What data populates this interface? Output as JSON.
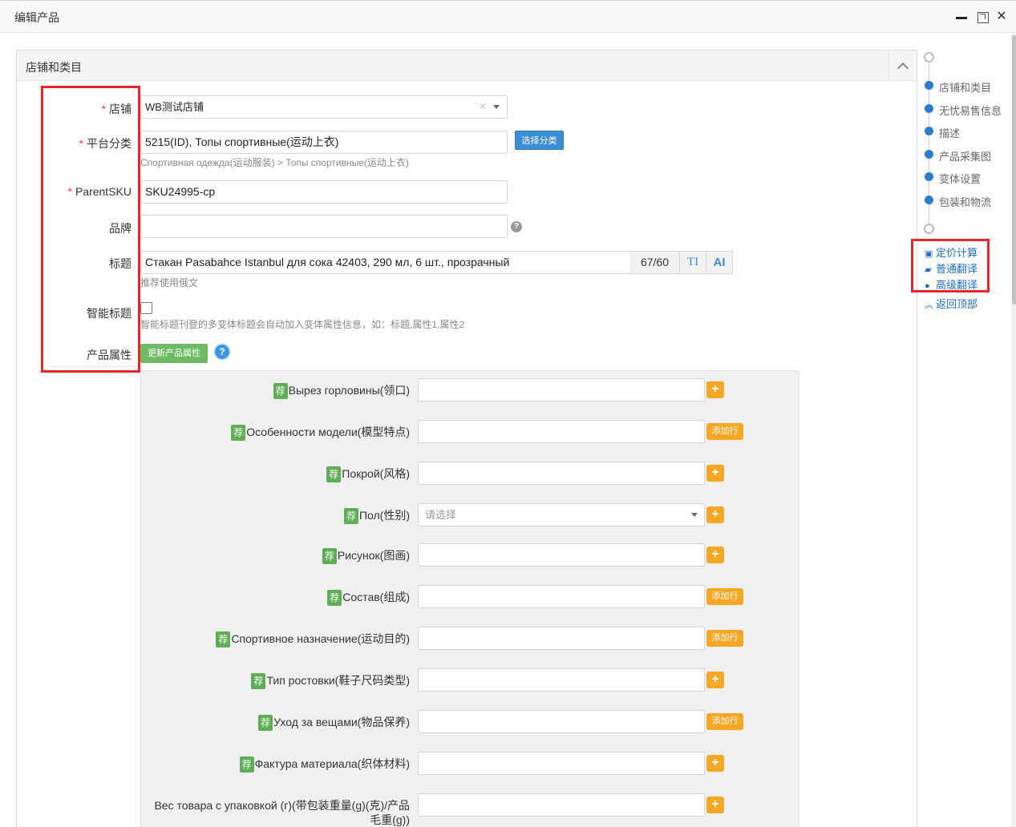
{
  "window": {
    "title": "编辑产品",
    "min_icon": "minimize-icon",
    "max_icon": "maximize-icon",
    "close_icon": "close-icon",
    "close_glyph": "✕"
  },
  "panel": {
    "title": "店铺和类目"
  },
  "form": {
    "required_mark": "*",
    "shop": {
      "label": "店铺",
      "value": "WB测试店铺",
      "clear": "✕"
    },
    "category": {
      "label": "平台分类",
      "value": "5215(ID), Топы спортивные(运动上衣)",
      "button": "选择分类",
      "path": "Спортивная одежда(运动服装) > Топы спортивные(运动上衣)"
    },
    "parent_sku": {
      "label": "ParentSKU",
      "value": "SKU24995-cp"
    },
    "brand": {
      "label": "品牌",
      "value": "",
      "help": "?"
    },
    "title": {
      "label": "标题",
      "value": "Стакан Pasabahce Istanbul для сока 42403, 290 мл, 6 шт., прозрачный",
      "count": "67/60",
      "tt": "TI",
      "ai": "AI",
      "hint": "推荐使用俄文"
    },
    "smart_title": {
      "label": "智能标题",
      "hint": "智能标题刊登的多变体标题会自动加入变体属性信息，如：标题,属性1,属性2"
    },
    "attributes": {
      "label": "产品属性",
      "update_button": "更新产品属性",
      "help": "?"
    }
  },
  "attr_rows": {
    "tag": "荐",
    "plus": "+",
    "add_row": "添加行",
    "select_placeholder": "请选择",
    "r0": "Вырез горловины(领口)",
    "r1": "Особенности модели(模型特点)",
    "r2": "Покрой(风格)",
    "r3": "Пол(性别)",
    "r4": "Рисунок(图画)",
    "r5": "Состав(组成)",
    "r6": "Спортивное назначение(运动目的)",
    "r7": "Тип ростовки(鞋子尺码类型)",
    "r8": "Уход за вещами(物品保养)",
    "r9": "Фактура материала(织体材料)",
    "r10": "Вес товара с упаковкой (г)(带包装重量(g)(克)/产品毛重(g))"
  },
  "side_nav": {
    "items": [
      "店铺和类目",
      "无忧易售信息",
      "描述",
      "产品采集图",
      "变体设置",
      "包装和物流"
    ],
    "tools": {
      "pricing": "定价计算",
      "normal_translate": "普通翻译",
      "advanced_translate": "高级翻译",
      "back_top": "返回顶部"
    }
  },
  "colors": {
    "accent_blue": "#3c8dd5",
    "highlight_red": "#e8262a",
    "tag_green": "#5fae57",
    "add_orange": "#f5a623"
  }
}
